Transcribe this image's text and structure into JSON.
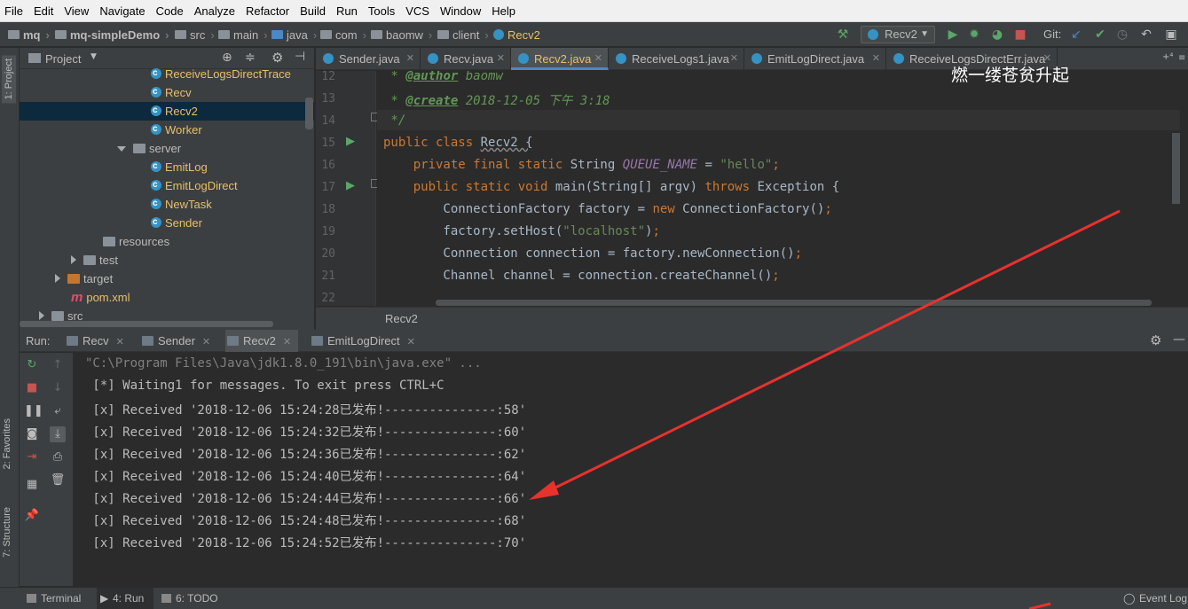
{
  "menu": [
    "File",
    "Edit",
    "View",
    "Navigate",
    "Code",
    "Analyze",
    "Refactor",
    "Build",
    "Run",
    "Tools",
    "VCS",
    "Window",
    "Help"
  ],
  "breadcrumb": [
    "mq",
    "mq-simpleDemo",
    "src",
    "main",
    "java",
    "com",
    "baomw",
    "client",
    "Recv2"
  ],
  "toolbar": {
    "run_config": "Recv2",
    "git_label": "Git:"
  },
  "left_strip": {
    "project": "1: Project",
    "favorites": "2: Favorites",
    "structure": "7: Structure"
  },
  "project_panel": {
    "title": "Project"
  },
  "tree": [
    {
      "label": "ReceiveLogsDirectTrace",
      "type": "class"
    },
    {
      "label": "Recv",
      "type": "class"
    },
    {
      "label": "Recv2",
      "type": "class",
      "selected": true
    },
    {
      "label": "Worker",
      "type": "class"
    },
    {
      "label": "server",
      "type": "package"
    },
    {
      "label": "EmitLog",
      "type": "class"
    },
    {
      "label": "EmitLogDirect",
      "type": "class"
    },
    {
      "label": "NewTask",
      "type": "class"
    },
    {
      "label": "Sender",
      "type": "class"
    },
    {
      "label": "resources",
      "type": "folder"
    },
    {
      "label": "test",
      "type": "folder"
    },
    {
      "label": "target",
      "type": "folder-orange"
    },
    {
      "label": "pom.xml",
      "type": "maven"
    },
    {
      "label": "src",
      "type": "folder"
    }
  ],
  "editor_tabs": [
    {
      "label": "Sender.java"
    },
    {
      "label": "Recv.java"
    },
    {
      "label": "Recv2.java",
      "active": true
    },
    {
      "label": "ReceiveLogs1.java"
    },
    {
      "label": "EmitLogDirect.java"
    },
    {
      "label": "ReceiveLogsDirectErr.java"
    }
  ],
  "code": {
    "line_numbers": [
      "12",
      "13",
      "14",
      "15",
      "16",
      "17",
      "18",
      "19",
      "20",
      "21",
      "22"
    ],
    "l12_star": " * ",
    "l12_tag": "@author",
    "l12_rest": " baomw",
    "l13_star": " * ",
    "l13_tag": "@create",
    "l13_rest": " 2018-12-05 下午 3:18",
    "l14": " */",
    "l15_kw": "public class ",
    "l15_rest": "Recv2 {",
    "l16_kw": "    private final static ",
    "l16_type": "String ",
    "l16_const": "QUEUE_NAME",
    "l16_eq": " = ",
    "l16_str": "\"hello\"",
    "l16_end": ";",
    "l17_kw": "    public static void ",
    "l17_mid": "main(String[] argv) ",
    "l17_kw2": "throws ",
    "l17_rest": "Exception {",
    "l18_a": "        ConnectionFactory factory = ",
    "l18_kw": "new ",
    "l18_b": "ConnectionFactory()",
    "l18_end": ";",
    "l19_a": "        factory.setHost(",
    "l19_str": "\"localhost\"",
    "l19_b": ")",
    "l19_end": ";",
    "l20_a": "        Connection connection = factory.newConnection()",
    "l20_end": ";",
    "l21_a": "        Channel channel = connection.createChannel()",
    "l21_end": ";"
  },
  "editor_breadcrumb": "Recv2",
  "watermark": "燃一缕苍贫升起",
  "run_panel": {
    "label": "Run:",
    "tabs": [
      {
        "label": "Recv"
      },
      {
        "label": "Sender"
      },
      {
        "label": "Recv2",
        "active": true
      },
      {
        "label": "EmitLogDirect"
      }
    ]
  },
  "console": [
    "\"C:\\Program Files\\Java\\jdk1.8.0_191\\bin\\java.exe\" ...",
    " [*] Waiting1 for messages. To exit press CTRL+C",
    " [x] Received '2018-12-06 15:24:28已发布!---------------:58'",
    " [x] Received '2018-12-06 15:24:32已发布!---------------:60'",
    " [x] Received '2018-12-06 15:24:36已发布!---------------:62'",
    " [x] Received '2018-12-06 15:24:40已发布!---------------:64'",
    " [x] Received '2018-12-06 15:24:44已发布!---------------:66'",
    " [x] Received '2018-12-06 15:24:48已发布!---------------:68'",
    " [x] Received '2018-12-06 15:24:52已发布!---------------:70'"
  ],
  "bottom_tabs": {
    "terminal": "Terminal",
    "run": "4: Run",
    "todo": "6: TODO",
    "event_log": "Event Log"
  },
  "colors": {
    "accent": "#4a88c7",
    "annotation_arrow": "#e8322d",
    "run_green": "#59a869"
  }
}
